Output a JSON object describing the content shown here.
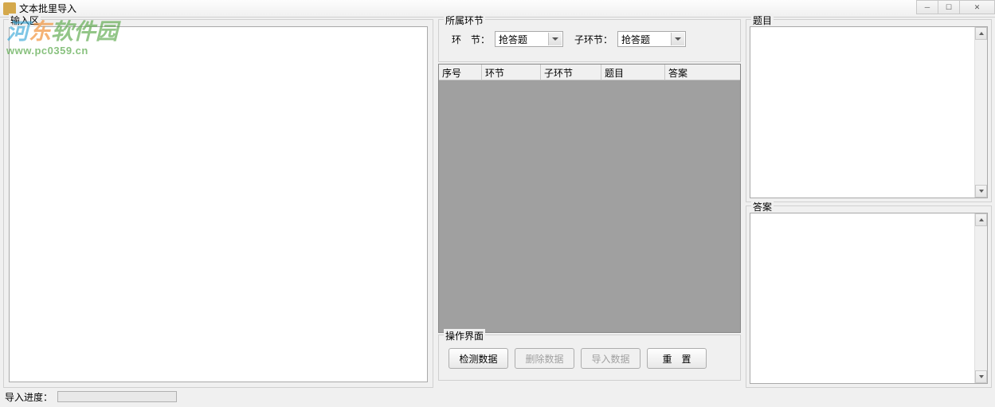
{
  "window": {
    "title": "文本批里导入"
  },
  "input_area": {
    "legend": "输入区",
    "value": ""
  },
  "section": {
    "legend": "所属环节",
    "label_main": "环　节：",
    "label_sub": "子环节：",
    "dropdown_main": "抢答题",
    "dropdown_sub": "抢答题"
  },
  "table": {
    "columns": [
      "序号",
      "环节",
      "子环节",
      "题目",
      "答案"
    ],
    "widths": [
      54,
      74,
      76,
      80,
      82
    ]
  },
  "ops": {
    "legend": "操作界面",
    "buttons": {
      "detect": "检测数据",
      "delete": "删除数据",
      "import": "导入数据",
      "reset": "重　置"
    }
  },
  "right": {
    "question_legend": "题目",
    "answer_legend": "答案"
  },
  "status": {
    "label": "导入进度："
  },
  "watermark": {
    "text": "河东软件园",
    "url": "www.pc0359.cn"
  }
}
